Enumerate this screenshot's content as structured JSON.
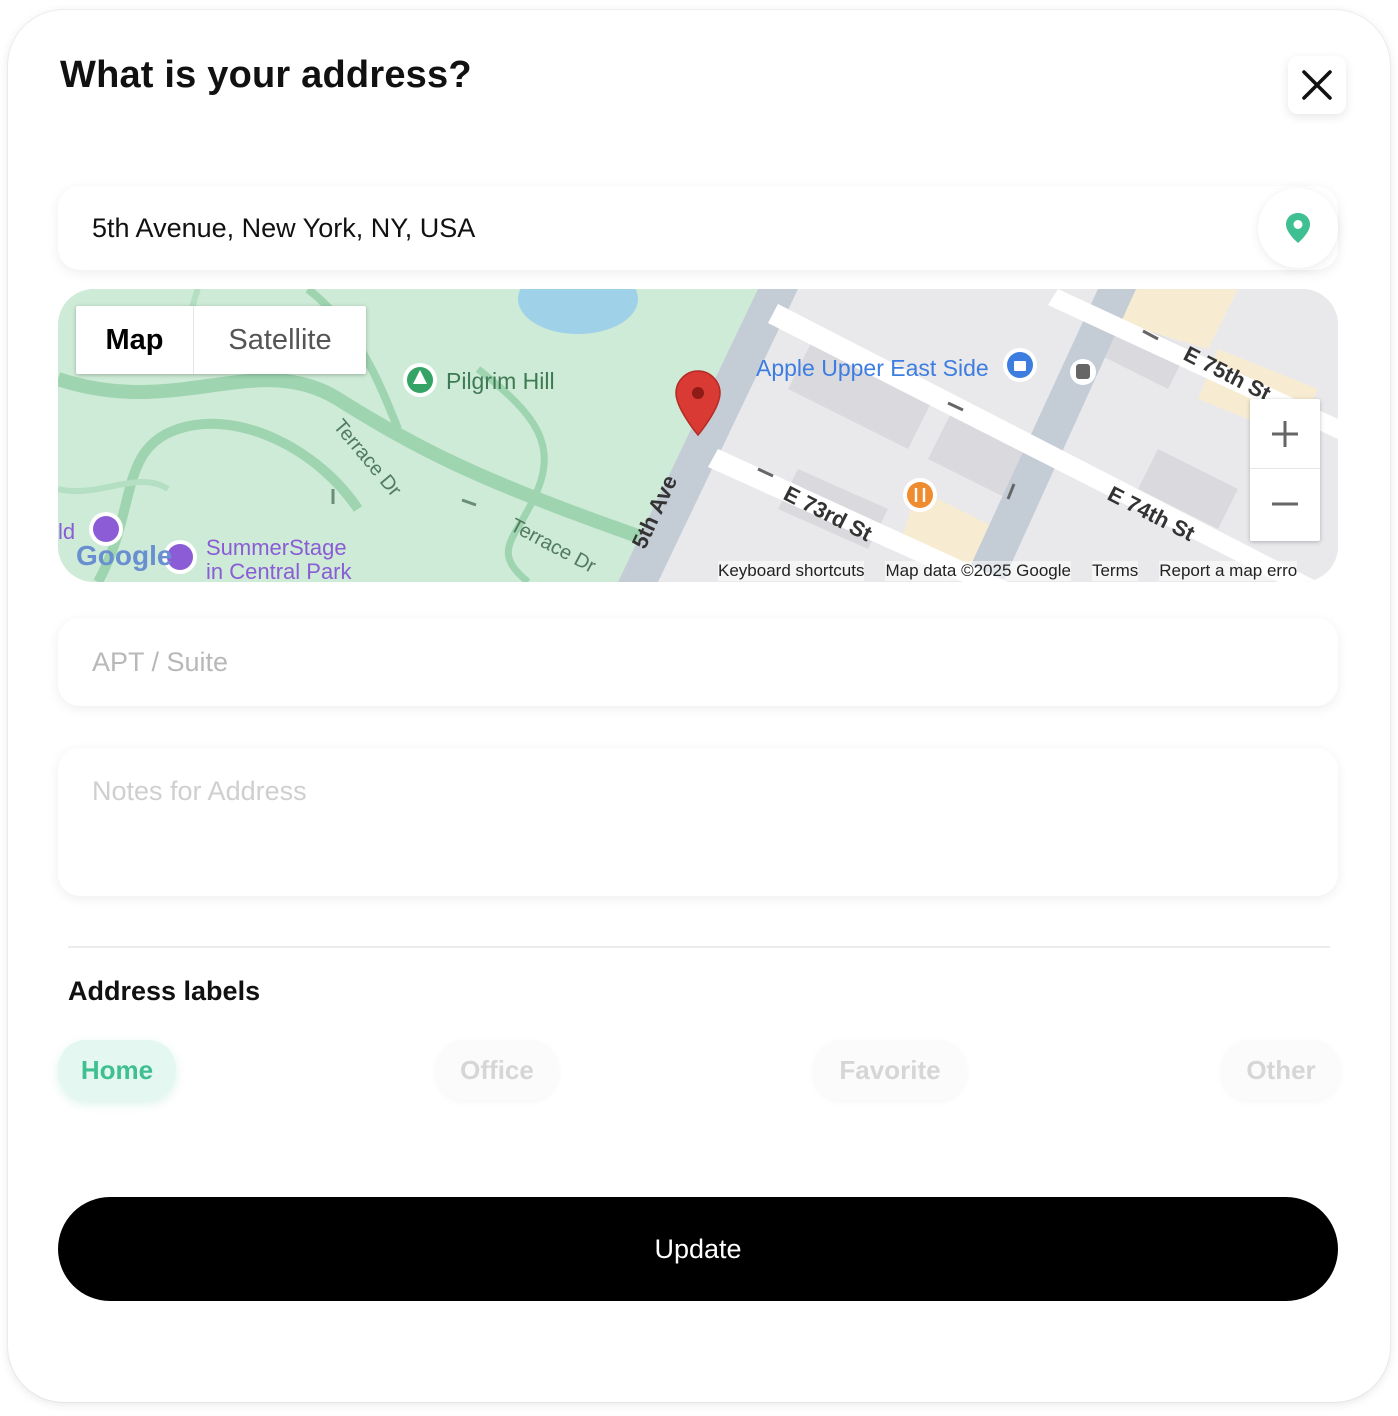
{
  "dialog": {
    "title": "What is your address?"
  },
  "address": {
    "value": "5th Avenue, New York, NY, USA"
  },
  "map": {
    "type_tabs": {
      "map": "Map",
      "satellite": "Satellite"
    },
    "labels": {
      "pilgrim_hill": "Pilgrim Hill",
      "terrace_dr_1": "Terrace Dr",
      "terrace_dr_2": "Terrace Dr",
      "fifth_ave": "5th Ave",
      "apple_store": "Apple Upper East Side",
      "e73": "E 73rd St",
      "e74": "E 74th St",
      "e75": "E 75th St",
      "summerstage_1": "SummerStage",
      "summerstage_2": "in Central Park",
      "partial_left": "ld",
      "google": "Google"
    },
    "zoom_in": "+",
    "zoom_out": "−",
    "attribution": {
      "shortcuts": "Keyboard shortcuts",
      "data": "Map data ©2025 Google",
      "terms": "Terms",
      "report": "Report a map erro"
    }
  },
  "apt": {
    "placeholder": "APT / Suite"
  },
  "notes": {
    "placeholder": "Notes for Address"
  },
  "labels_section": {
    "heading": "Address labels",
    "chips": [
      {
        "label": "Home",
        "selected": true
      },
      {
        "label": "Office",
        "selected": false
      },
      {
        "label": "Favorite",
        "selected": false
      },
      {
        "label": "Other",
        "selected": false
      }
    ]
  },
  "update_button": {
    "label": "Update"
  },
  "colors": {
    "accent": "#3fbf92",
    "marker": "#d93a33",
    "primary_button": "#000000"
  }
}
